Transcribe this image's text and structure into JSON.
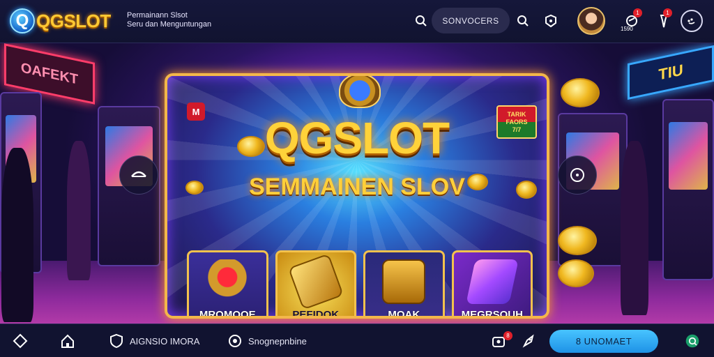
{
  "header": {
    "logo_letter": "Q",
    "logo_text": "QGSLOT",
    "tagline_line1": "Permainann Slsot",
    "tagline_line2": "Seru dan Menguntungan",
    "search_label": "SONVOCERS",
    "notif_badge_1": "1",
    "notif_badge_2": "1",
    "notif_count": "1590"
  },
  "banner": {
    "title": "QGSLOT",
    "subtitle": "SEMMAINEN SLOV",
    "corner_badge": "M",
    "sticker_line1": "TARIK",
    "sticker_line2": "FAORS",
    "sticker_line3": "7/7",
    "left_sign": "OAFEKT",
    "right_sign": "TIU"
  },
  "tiles": [
    {
      "label": "MROMOOE"
    },
    {
      "label": "PEFIDOK"
    },
    {
      "label": "MOAK"
    },
    {
      "label": "MEGRSOUH"
    }
  ],
  "bottom": {
    "item1_label": "AIGNSIO IMORA",
    "item2_label": "Snognepnbine",
    "cart_badge": "8",
    "cta_label": "8 UNOMAET"
  },
  "colors": {
    "accent_gold": "#ffc933",
    "cta_blue": "#2aa8f0",
    "badge_red": "#e0202a",
    "background": "#14112e"
  },
  "icons": [
    "search-icon",
    "gift-icon",
    "notification-icon",
    "pin-icon",
    "menu-icon",
    "home-icon",
    "chevron-left-icon",
    "chevron-right-icon",
    "support-icon"
  ]
}
